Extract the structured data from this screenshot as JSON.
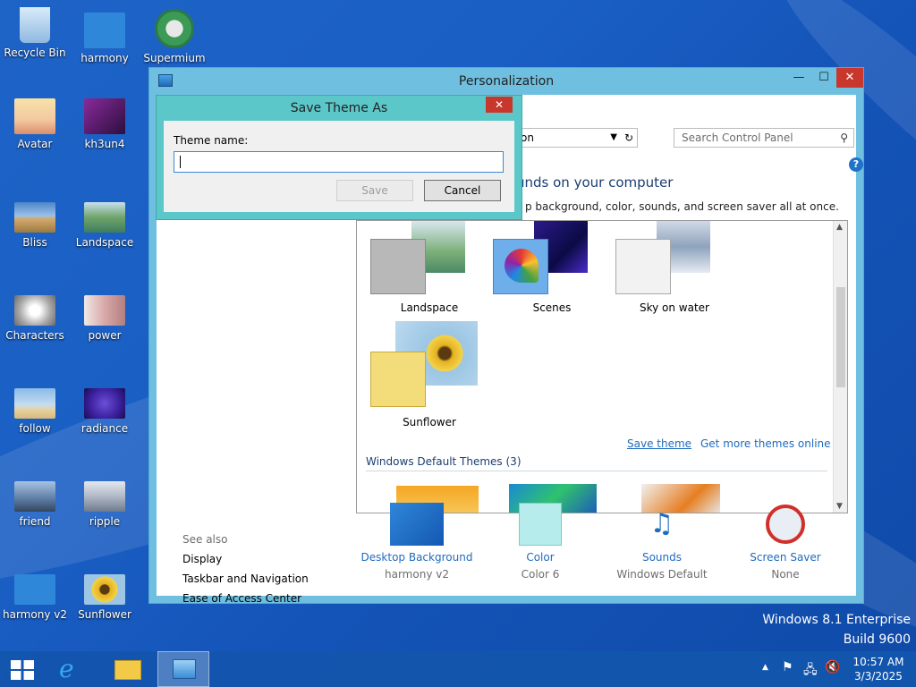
{
  "desktop": {
    "icons": [
      {
        "label": "Recycle Bin",
        "icon": "recycle-bin-icon",
        "color": "#9cc4e8"
      },
      {
        "label": "harmony",
        "icon": "harmony-icon",
        "color": "#2f87d9"
      },
      {
        "label": "Supermium",
        "icon": "supermium-icon",
        "color": "#3c9a57"
      },
      {
        "label": "Avatar",
        "icon": "avatar-icon",
        "color": "#f3c8a2"
      },
      {
        "label": "kh3un4",
        "icon": "kh3un4-icon",
        "color": "#6d2d8a"
      },
      {
        "label": "Bliss",
        "icon": "bliss-icon",
        "color": "#d4a86d"
      },
      {
        "label": "Landspace",
        "icon": "landspace-icon",
        "color": "#6fa46b"
      },
      {
        "label": "Characters",
        "icon": "characters-icon",
        "color": "#cfcfcf"
      },
      {
        "label": "power",
        "icon": "power-icon",
        "color": "#d9a8a8"
      },
      {
        "label": "follow",
        "icon": "follow-icon",
        "color": "#8ab9e8"
      },
      {
        "label": "radiance",
        "icon": "radiance-icon",
        "color": "#3b1f9b"
      },
      {
        "label": "friend",
        "icon": "friend-icon",
        "color": "#5b7aa2"
      },
      {
        "label": "ripple",
        "icon": "ripple-icon",
        "color": "#b0b8c7"
      },
      {
        "label": "harmony v2",
        "icon": "harmony-v2-icon",
        "color": "#2f87d9"
      },
      {
        "label": "Sunflower",
        "icon": "sunflower-icon",
        "color": "#e4b21f"
      }
    ],
    "watermark_line1": "Windows 8.1 Enterprise",
    "watermark_line2": "Build 9600"
  },
  "window": {
    "title": "Personalization",
    "minimize": "—",
    "maximize": "☐",
    "close": "✕",
    "address_text": "on",
    "search_placeholder": "Search Control Panel",
    "heading": "unds on your computer",
    "subheading": "p background, color, sounds, and screen saver all at once.",
    "help": "?",
    "themes": [
      {
        "label": "Landspace"
      },
      {
        "label": "Scenes"
      },
      {
        "label": "Sky on water"
      },
      {
        "label": "Sunflower"
      }
    ],
    "save_theme": "Save theme",
    "get_more": "Get more themes online",
    "default_header": "Windows Default Themes (3)",
    "see_also": {
      "title": "See also",
      "items": [
        "Display",
        "Taskbar and Navigation",
        "Ease of Access Center"
      ]
    },
    "bottom": [
      {
        "title": "Desktop Background",
        "sub": "harmony v2",
        "icon": "desktop-background-icon"
      },
      {
        "title": "Color",
        "sub": "Color 6",
        "icon": "color-icon"
      },
      {
        "title": "Sounds",
        "sub": "Windows Default",
        "icon": "sounds-icon"
      },
      {
        "title": "Screen Saver",
        "sub": "None",
        "icon": "screen-saver-icon"
      }
    ]
  },
  "dialog": {
    "title": "Save Theme As",
    "close": "✕",
    "label": "Theme name:",
    "value": "",
    "save_label": "Save",
    "cancel_label": "Cancel"
  },
  "taskbar": {
    "time": "10:57 AM",
    "date": "3/3/2025"
  },
  "colors": {
    "accent": "#5cc7c9",
    "link": "#1f6bbd",
    "taskbar": "#1355ad"
  }
}
